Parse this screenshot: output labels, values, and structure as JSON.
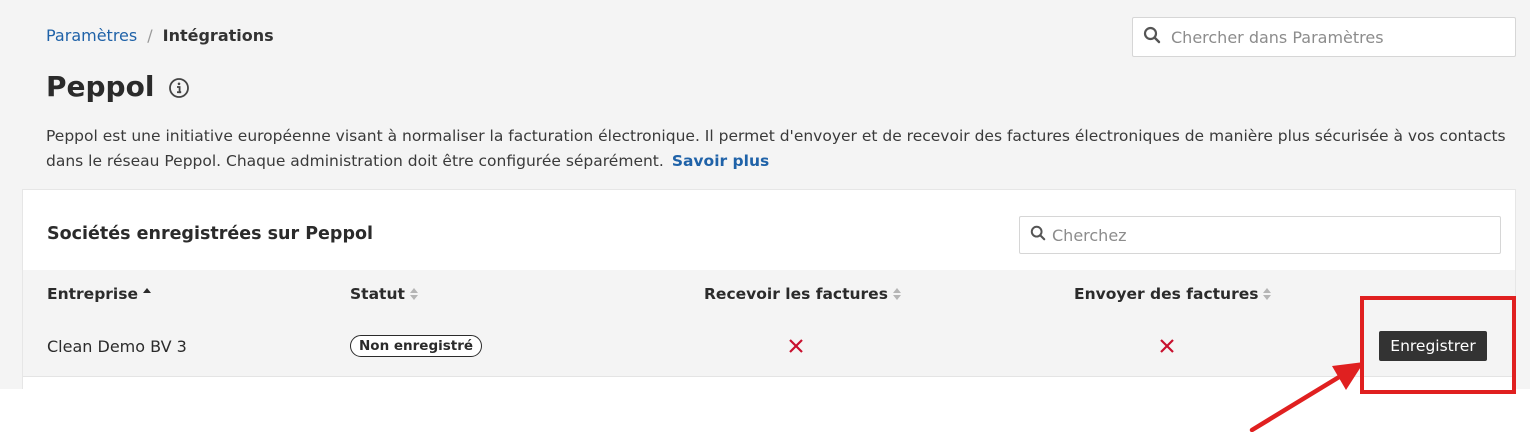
{
  "breadcrumb": {
    "parent": "Paramètres",
    "separator": "/",
    "current": "Intégrations"
  },
  "global_search": {
    "placeholder": "Chercher dans Paramètres",
    "value": ""
  },
  "page": {
    "title": "Peppol",
    "description": "Peppol est une initiative européenne visant à normaliser la facturation électronique. Il permet d'envoyer et de recevoir des factures électroniques de manière plus sécurisée à vos contacts dans le réseau Peppol. Chaque administration doit être configurée séparément.",
    "learn_more": "Savoir plus"
  },
  "panel": {
    "title": "Sociétés enregistrées sur Peppol",
    "search": {
      "placeholder": "Cherchez",
      "value": ""
    },
    "columns": [
      "Entreprise",
      "Statut",
      "Recevoir les factures",
      "Envoyer des factures"
    ],
    "sorted_column": "Entreprise",
    "rows": [
      {
        "company": "Clean Demo BV 3",
        "status": "Non enregistré",
        "receive_invoices": "no",
        "send_invoices": "no",
        "action": "Enregistrer"
      }
    ]
  },
  "icons": {
    "search": "search-icon",
    "info": "info-circle-icon",
    "cross": "cross-icon",
    "sort": "sort-icon"
  },
  "colors": {
    "link": "#1f62a8",
    "cross": "#c8102e",
    "annotation": "#e02020",
    "button": "#333333"
  }
}
